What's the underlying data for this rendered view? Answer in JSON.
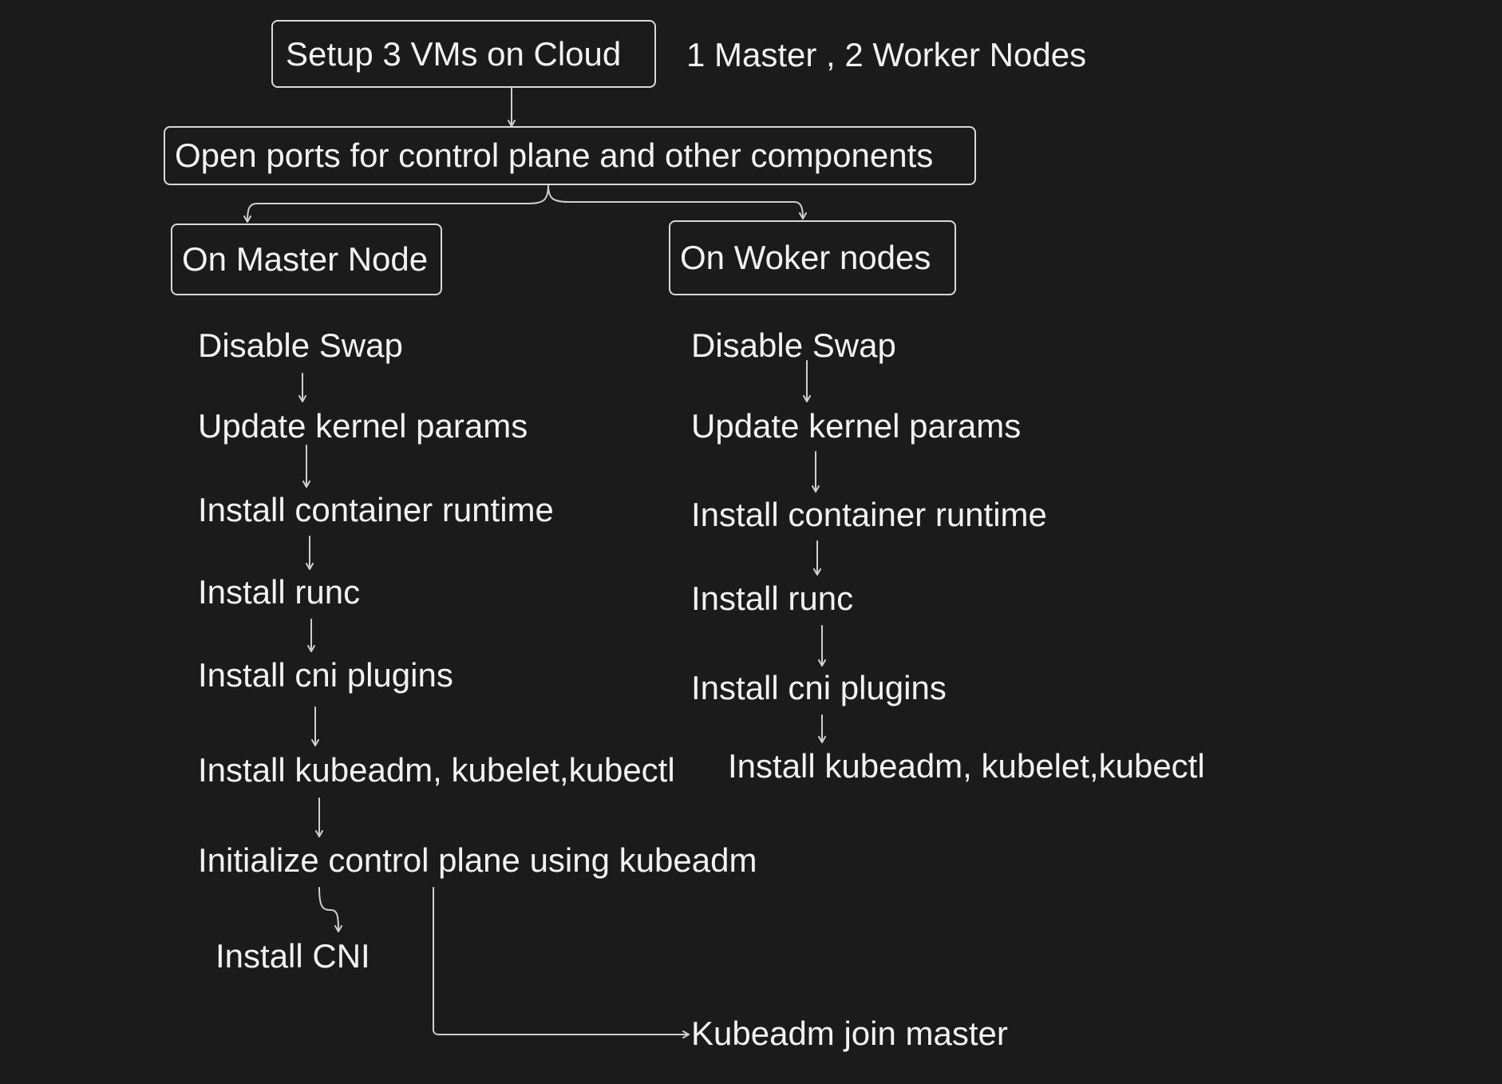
{
  "diagram": {
    "top": {
      "setup_box": "Setup 3 VMs on Cloud",
      "note": "1 Master , 2 Worker Nodes",
      "ports_box": "Open ports for control plane and other components"
    },
    "master": {
      "header": "On Master Node",
      "steps": [
        "Disable Swap",
        "Update kernel params",
        "Install container runtime",
        "Install runc",
        "Install cni plugins",
        "Install kubeadm, kubelet,kubectl",
        "Initialize control plane using kubeadm",
        "Install CNI"
      ]
    },
    "worker": {
      "header": "On Woker nodes",
      "steps": [
        "Disable Swap",
        "Update kernel params",
        "Install container runtime",
        "Install runc",
        "Install cni plugins",
        "Install kubeadm, kubelet,kubectl"
      ]
    },
    "join": "Kubeadm join master"
  }
}
